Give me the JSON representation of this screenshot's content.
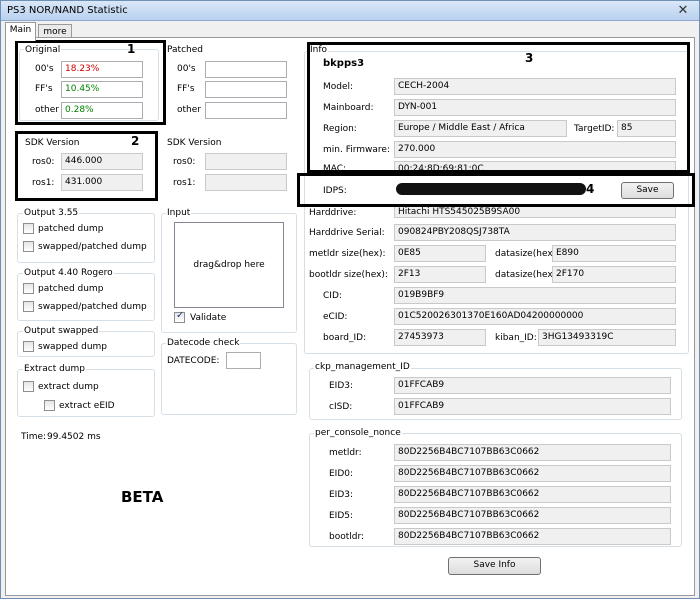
{
  "window": {
    "title": "PS3 NOR/NAND Statistic",
    "close_glyph": "✕"
  },
  "tabs": [
    {
      "label": "Main"
    },
    {
      "label": "more"
    }
  ],
  "original": {
    "title": "Original",
    "rows": [
      {
        "label": "00's",
        "value": "18.23%",
        "color": "#cc0000"
      },
      {
        "label": "FF's",
        "value": "10.45%",
        "color": "#008000"
      },
      {
        "label": "other",
        "value": "0.28%",
        "color": "#008000"
      }
    ]
  },
  "patched": {
    "title": "Patched",
    "rows": [
      {
        "label": "00's",
        "value": ""
      },
      {
        "label": "FF's",
        "value": ""
      },
      {
        "label": "other",
        "value": ""
      }
    ]
  },
  "sdk_left": {
    "title": "SDK Version",
    "rows": [
      {
        "label": "ros0:",
        "value": "446.000"
      },
      {
        "label": "ros1:",
        "value": "431.000"
      }
    ]
  },
  "sdk_right": {
    "title": "SDK Version",
    "rows": [
      {
        "label": "ros0:",
        "value": ""
      },
      {
        "label": "ros1:",
        "value": ""
      }
    ]
  },
  "output355": {
    "title": "Output 3.55",
    "items": [
      "patched dump",
      "swapped/patched dump"
    ]
  },
  "output440": {
    "title": "Output 4.40 Rogero",
    "items": [
      "patched dump",
      "swapped/patched dump"
    ]
  },
  "output_swapped": {
    "title": "Output swapped",
    "items": [
      "swapped dump"
    ]
  },
  "extract": {
    "title": "Extract dump",
    "items": [
      "extract dump",
      "extract eEID"
    ]
  },
  "input": {
    "title": "Input",
    "drop_text": "drag&drop here",
    "validate_label": "Validate",
    "validate_checked": true
  },
  "datecode": {
    "title": "Datecode check",
    "label": "DATECODE:",
    "value": ""
  },
  "time": {
    "label": "Time:",
    "value": "99.4502 ms"
  },
  "beta": "BETA",
  "info": {
    "title": "Info",
    "name": "bkpps3",
    "model_label": "Model:",
    "model": "CECH-2004",
    "mainboard_label": "Mainboard:",
    "mainboard": "DYN-001",
    "region_label": "Region:",
    "region": "Europe / Middle East / Africa",
    "targetid_label": "TargetID:",
    "targetid": "85",
    "firmware_label": "min. Firmware:",
    "firmware": "270.000",
    "mac_label": "MAC:",
    "mac": "00:24:8D:69:81:0C",
    "idps_label": "IDPS:",
    "save_label": "Save",
    "harddrive_label": "Harddrive:",
    "harddrive": "Hitachi HTS545025B9SA00",
    "hdd_serial_label": "Harddrive Serial:",
    "hdd_serial": "090824PBY208QSJ738TA",
    "metldr_label": "metldr size(hex):",
    "metldr": "0E85",
    "datasize1_label": "datasize(hex):",
    "datasize1": "E890",
    "bootldr_label": "bootldr size(hex):",
    "bootldr": "2F13",
    "datasize2_label": "datasize(hex):",
    "datasize2": "2F170",
    "cid_label": "CID:",
    "cid": "019B9BF9",
    "ecid_label": "eCID:",
    "ecid": "01C520026301370E160AD04200000000",
    "boardid_label": "board_ID:",
    "boardid": "27453973",
    "kibanid_label": "kiban_ID:",
    "kibanid": "3HG13493319C"
  },
  "ckp": {
    "title": "ckp_management_ID",
    "rows": [
      {
        "label": "EID3:",
        "value": "01FFCAB9"
      },
      {
        "label": "cISD:",
        "value": "01FFCAB9"
      }
    ]
  },
  "nonce": {
    "title": "per_console_nonce",
    "rows": [
      {
        "label": "metldr:",
        "value": "80D2256B4BC7107BB63C0662"
      },
      {
        "label": "EID0:",
        "value": "80D2256B4BC7107BB63C0662"
      },
      {
        "label": "EID3:",
        "value": "80D2256B4BC7107BB63C0662"
      },
      {
        "label": "EID5:",
        "value": "80D2256B4BC7107BB63C0662"
      },
      {
        "label": "bootldr:",
        "value": "80D2256B4BC7107BB63C0662"
      }
    ]
  },
  "save_info_label": "Save Info",
  "annotations": [
    "1",
    "2",
    "3",
    "4"
  ]
}
